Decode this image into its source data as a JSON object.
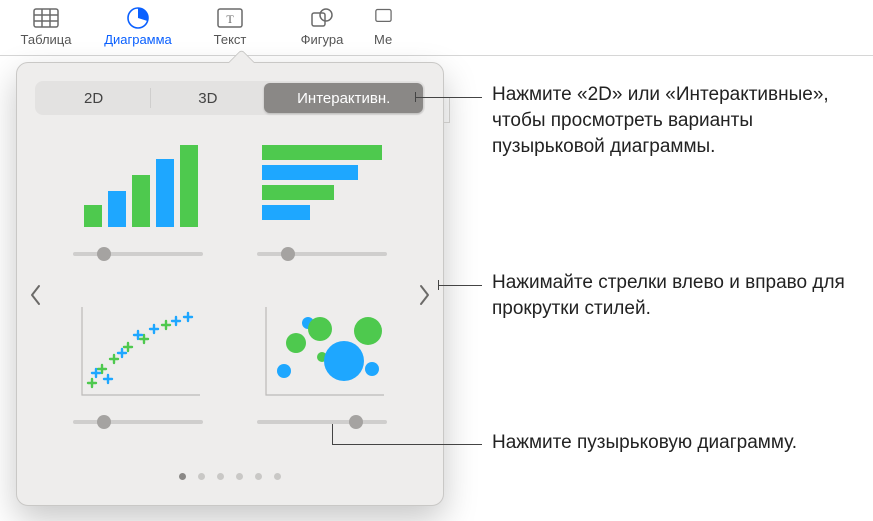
{
  "toolbar": {
    "table": "Таблица",
    "chart": "Диаграмма",
    "text": "Текст",
    "shape": "Фигура",
    "media": "Ме"
  },
  "segmented": {
    "tab1": "2D",
    "tab2": "3D",
    "tab3": "Интерактивн."
  },
  "callouts": {
    "c1": "Нажмите «2D» или «Интерактивные», чтобы просмотреть варианты пузырьковой диаграммы.",
    "c2": "Нажимайте стрелки влево и вправо для прокрутки стилей.",
    "c3": "Нажмите пузырьковую диаграмму."
  },
  "pager": {
    "count": 6,
    "current": 0
  },
  "colors": {
    "blue": "#1ea7ff",
    "green": "#4ec94e"
  }
}
